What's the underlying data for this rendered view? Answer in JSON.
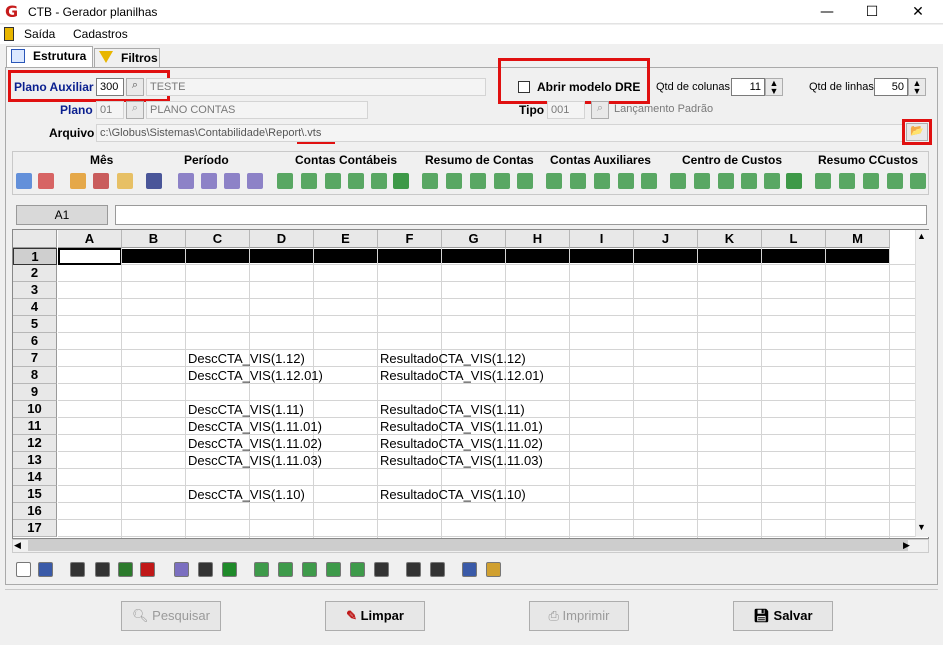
{
  "window": {
    "title": "CTB - Gerador planilhas",
    "minimize": "—",
    "maximize": "☐",
    "close": "✕"
  },
  "menu": {
    "items": [
      "Saída",
      "Cadastros"
    ]
  },
  "tabs": [
    "Estrutura",
    "Filtros"
  ],
  "form": {
    "plano_auxiliar_label": "Plano Auxiliar",
    "plano_auxiliar_value": "300",
    "plano_auxiliar_desc": "TESTE",
    "abrir_modelo_label": "Abrir modelo DRE",
    "qtd_colunas_label": "Qtd de colunas",
    "qtd_colunas_value": "11",
    "qtd_linhas_label": "Qtd de linhas",
    "qtd_linhas_value": "50",
    "plano_label": "Plano",
    "plano_value": "01",
    "plano_desc": "PLANO CONTAS",
    "tipo_label": "Tipo",
    "tipo_value": "001",
    "tipo_desc": "Lançamento Padrão",
    "arquivo_label": "Arquivo",
    "arquivo_value": "c:\\Globus\\Sistemas\\Contabilidade\\Report\\.vts"
  },
  "categories": [
    "Mês",
    "Período",
    "Contas Contábeis",
    "Resumo de Contas",
    "Contas Auxiliares",
    "Centro de Custos",
    "Resumo CCustos"
  ],
  "colors": {
    "red_highlight": "#e01010",
    "selected_row": "#000000",
    "accent_blue": "#0a1f8f"
  },
  "formula": {
    "cell_ref": "A1",
    "value": ""
  },
  "grid": {
    "columns": [
      "A",
      "B",
      "C",
      "D",
      "E",
      "F",
      "G",
      "H",
      "I",
      "J",
      "K",
      "L",
      "M"
    ],
    "rows": [
      "1",
      "2",
      "3",
      "4",
      "5",
      "6",
      "7",
      "8",
      "9",
      "10",
      "11",
      "12",
      "13",
      "14",
      "15",
      "16",
      "17"
    ],
    "cells": [
      {
        "row": 7,
        "c": "DescCTA_VIS(1.12)",
        "f": "ResultadoCTA_VIS(1.12)"
      },
      {
        "row": 8,
        "c": "DescCTA_VIS(1.12.01)",
        "f": "ResultadoCTA_VIS(1.12.01)"
      },
      {
        "row": 10,
        "c": "DescCTA_VIS(1.11)",
        "f": "ResultadoCTA_VIS(1.11)"
      },
      {
        "row": 11,
        "c": "DescCTA_VIS(1.11.01)",
        "f": "ResultadoCTA_VIS(1.11.01)"
      },
      {
        "row": 12,
        "c": "DescCTA_VIS(1.11.02)",
        "f": "ResultadoCTA_VIS(1.11.02)"
      },
      {
        "row": 13,
        "c": "DescCTA_VIS(1.11.03)",
        "f": "ResultadoCTA_VIS(1.11.03)"
      },
      {
        "row": 15,
        "c": "DescCTA_VIS(1.10)",
        "f": "ResultadoCTA_VIS(1.10)"
      }
    ]
  },
  "bottom": {
    "pesquisar": "Pesquisar",
    "limpar": "Limpar",
    "imprimir": "Imprimir",
    "salvar": "Salvar"
  }
}
